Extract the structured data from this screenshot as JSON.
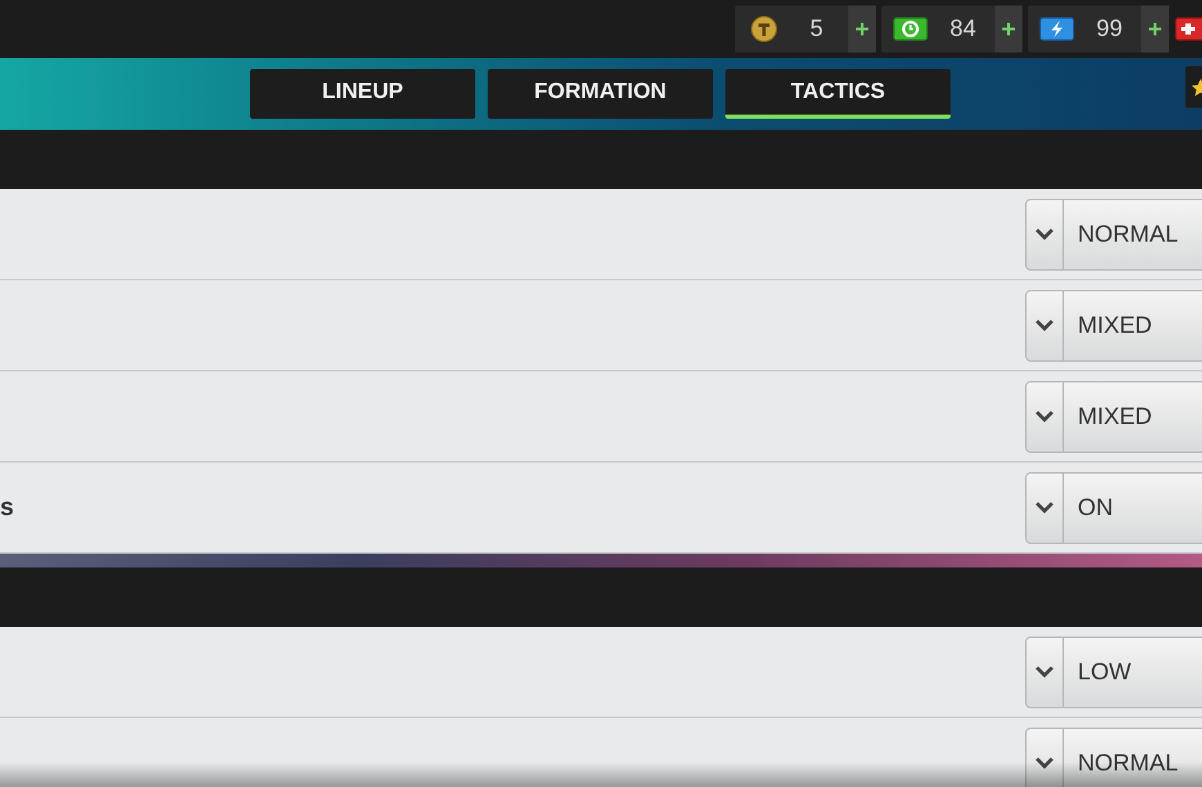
{
  "currencies": [
    {
      "kind": "coin",
      "value": "5",
      "plus": "+"
    },
    {
      "kind": "cash",
      "value": "84",
      "plus": "+"
    },
    {
      "kind": "energy",
      "value": "99",
      "plus": "+"
    },
    {
      "kind": "health"
    }
  ],
  "tabs": [
    {
      "label": "LINEUP",
      "selected": false
    },
    {
      "label": "FORMATION",
      "selected": false
    },
    {
      "label": "TACTICS",
      "selected": true
    }
  ],
  "sections": [
    {
      "rows": [
        {
          "value": "NORMAL"
        },
        {
          "value": "MIXED"
        },
        {
          "value": "MIXED"
        },
        {
          "label": "s",
          "value": "ON"
        }
      ]
    },
    {
      "rows": [
        {
          "value": "LOW"
        },
        {
          "value": "NORMAL"
        }
      ]
    }
  ]
}
